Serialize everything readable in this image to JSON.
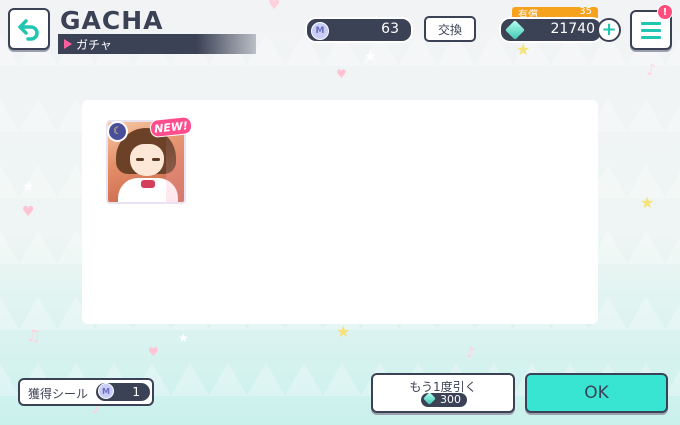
{
  "header": {
    "title_en": "GACHA",
    "title_jp": "ガチャ",
    "back_icon": "back-arrow-icon",
    "menu_icon": "hamburger-menu-icon",
    "menu_alert": "!"
  },
  "currency": {
    "seal_count": "63",
    "exchange_label": "交換",
    "paid_label": "有償",
    "paid_gems": "35",
    "gems_total": "21740",
    "add_icon": "plus-icon"
  },
  "result": {
    "card_attribute_icon": "moon-icon",
    "new_badge": "NEW!"
  },
  "footer": {
    "seal_label": "獲得シール",
    "seal_obtained": "1",
    "again_label": "もう1度引く",
    "again_cost": "300",
    "ok_label": "OK"
  },
  "colors": {
    "navy": "#3c4256",
    "accent_teal": "#38e5d3",
    "accent_pink": "#ff4d8d",
    "paid_orange": "#f6a21c"
  }
}
